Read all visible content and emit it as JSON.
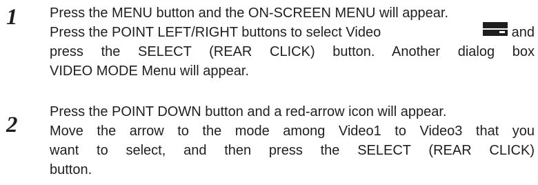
{
  "steps": [
    {
      "number": "1",
      "lines": [
        "Press the MENU button and the ON-SCREEN MENU will appear.",
        {
          "before_icon": "Press the POINT LEFT/RIGHT buttons to select Video",
          "icon": "video-icon",
          "after_icon": "and"
        },
        "press the SELECT (REAR CLICK) button.  Another dialog box",
        "VIDEO MODE Menu will appear."
      ]
    },
    {
      "number": "2",
      "lines": [
        "Press the POINT DOWN button and a red-arrow icon will appear.",
        "Move the arrow to the mode among Video1 to Video3  that you",
        "want to select, and then press the SELECT (REAR CLICK)",
        "button."
      ]
    }
  ]
}
